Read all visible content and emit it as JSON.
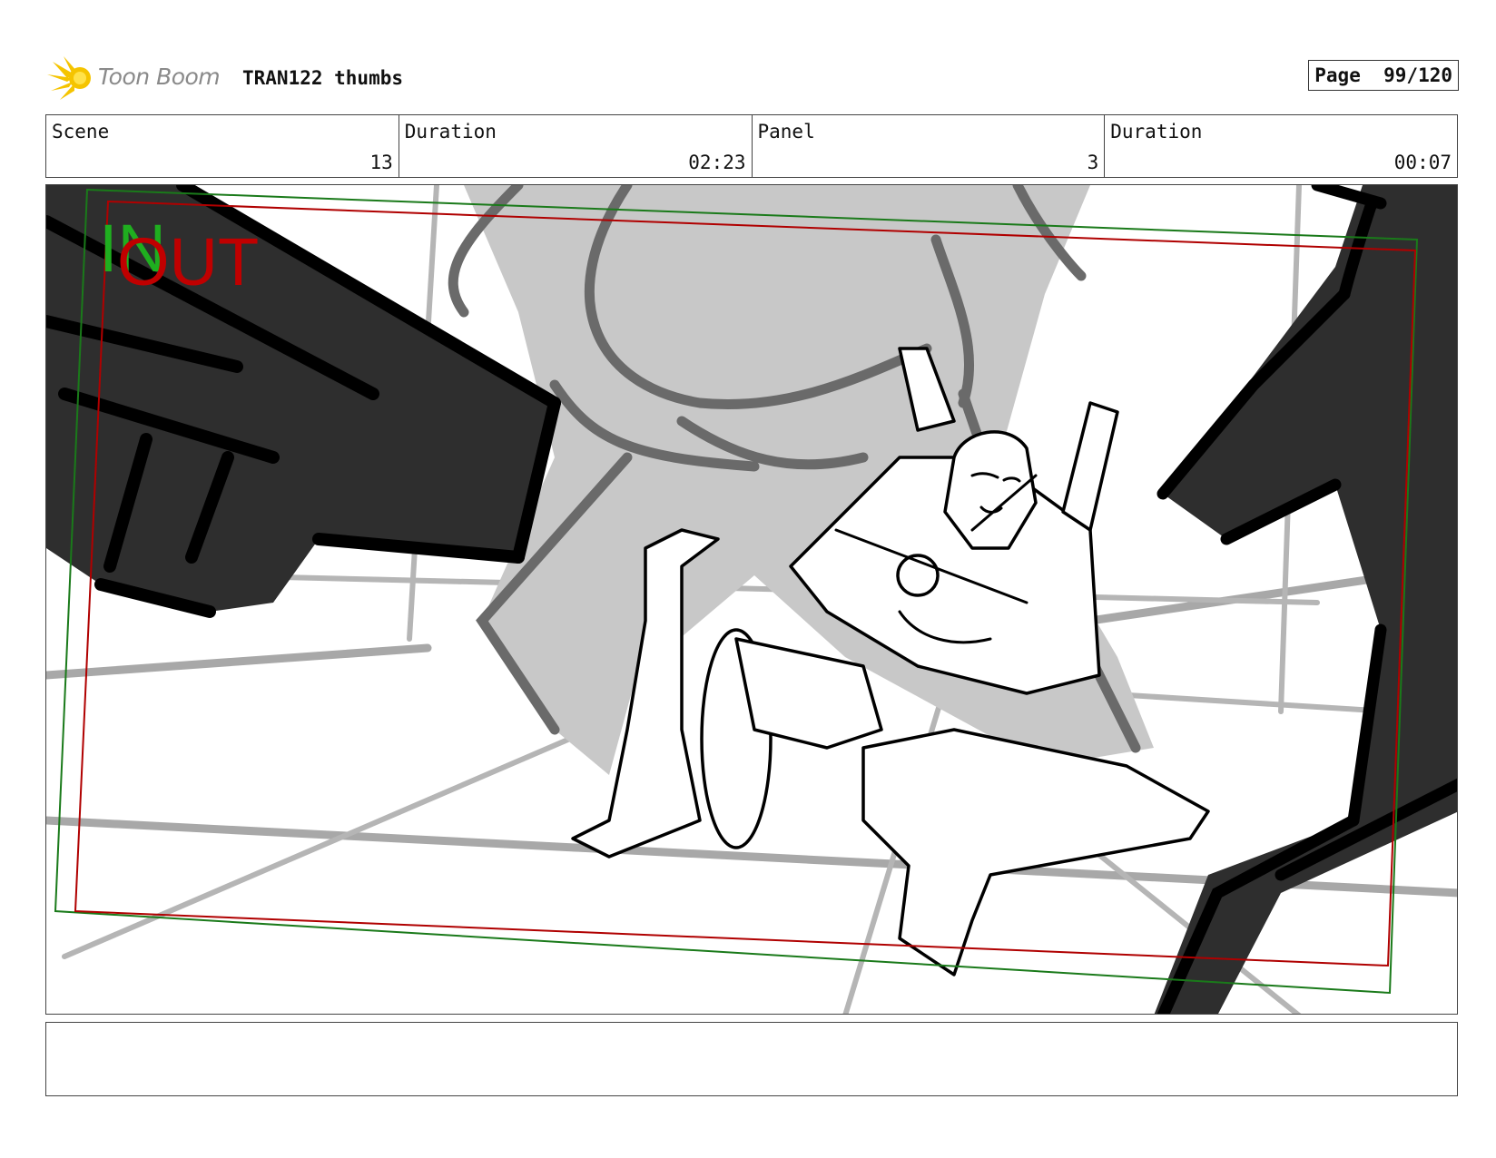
{
  "header": {
    "brand": "Toon Boom",
    "project_title": "TRAN122 thumbs",
    "page_label": "Page",
    "page_value": "99/120"
  },
  "info": {
    "scene_label": "Scene",
    "scene_value": "13",
    "scene_duration_label": "Duration",
    "scene_duration_value": "02:23",
    "panel_label": "Panel",
    "panel_value": "3",
    "panel_duration_label": "Duration",
    "panel_duration_value": "00:07"
  },
  "frame_markers": {
    "in_label": "IN",
    "out_label": "OUT",
    "in_color": "#1fae1f",
    "out_color": "#c00000"
  },
  "notes": {
    "text": ""
  }
}
